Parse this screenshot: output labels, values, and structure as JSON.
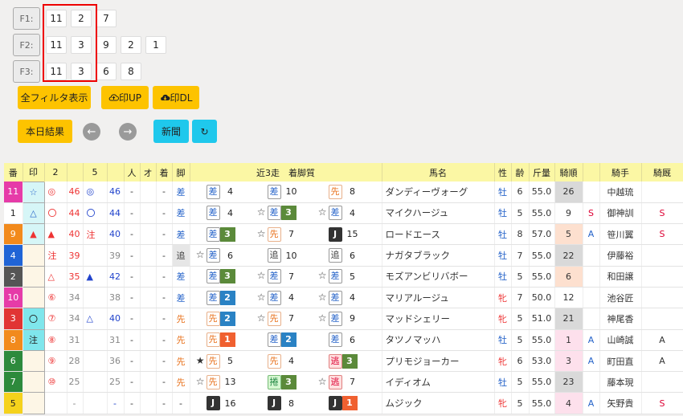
{
  "filters": [
    {
      "label": "F1:",
      "values": [
        "11",
        "2",
        "7"
      ]
    },
    {
      "label": "F2:",
      "values": [
        "11",
        "3",
        "9",
        "2",
        "1"
      ]
    },
    {
      "label": "F3:",
      "values": [
        "11",
        "3",
        "6",
        "8"
      ]
    }
  ],
  "buttons": {
    "all_filter": "全フィルタ表示",
    "mark_up": "印UP",
    "mark_dl": "印DL",
    "today_results": "本日結果",
    "newspaper": "新聞",
    "prev": "←",
    "next": "→",
    "refresh": "↻"
  },
  "colors": {
    "accent_yellow": "#fdc300",
    "accent_cyan": "#1fc8ec",
    "header_bg": "#fbf7a4",
    "red_box": "#ee0000"
  },
  "table": {
    "headers": [
      "番",
      "印",
      "2",
      "",
      "5",
      "",
      "人",
      "オ",
      "着",
      "脚",
      "近3走　着脚質",
      "馬名",
      "性",
      "齢",
      "斤量",
      "騎順",
      "",
      "騎手",
      "騎厩"
    ],
    "rows": [
      {
        "num": "11",
        "nc": "#e63ba8",
        "mark": "☆",
        "mc": "#2563c9",
        "mbg": "#d6f6f7",
        "s2": "◎",
        "v2": "46",
        "s5": "◎",
        "v5": "46",
        "ninki": "-",
        "o": "",
        "chaku": "-",
        "kyaku": "差",
        "kt": "s",
        "r": [
          {
            "st": "",
            "b": "差",
            "bt": "",
            "p": "4",
            "pc": ""
          },
          {
            "st": "",
            "b": "差",
            "bt": "",
            "p": "10",
            "pc": ""
          },
          {
            "st": "",
            "b": "先",
            "bt": "o",
            "p": "8",
            "pc": ""
          }
        ],
        "name": "ダンディーヴォーグ",
        "sex": "牡",
        "sf": false,
        "age": "6",
        "kin": "55.0",
        "jun": "26",
        "jbg": "#d9d9d9",
        "flag": "",
        "jockey": "中越琉",
        "kk": ""
      },
      {
        "num": "1",
        "nc": "#ffffff",
        "mark": "△",
        "mc": "#2563c9",
        "mbg": "#d6f6f7",
        "s2": "〇",
        "v2": "44",
        "s5": "〇",
        "v5": "44",
        "ninki": "-",
        "o": "",
        "chaku": "-",
        "kyaku": "差",
        "kt": "s",
        "r": [
          {
            "st": "",
            "b": "差",
            "bt": "",
            "p": "4",
            "pc": ""
          },
          {
            "st": "☆",
            "b": "差",
            "bt": "",
            "p": "3",
            "pc": "#5b8a3a"
          },
          {
            "st": "☆",
            "b": "差",
            "bt": "",
            "p": "4",
            "pc": ""
          }
        ],
        "name": "マイクハージュ",
        "sex": "牡",
        "sf": false,
        "age": "5",
        "kin": "55.0",
        "jun": "9",
        "jbg": "#ffffff",
        "flag": "S",
        "jockey": "御神訓",
        "kk": "S"
      },
      {
        "num": "9",
        "nc": "#f28a1c",
        "mark": "▲",
        "mc": "#e33",
        "mbg": "#d6f6f7",
        "s2": "▲",
        "v2": "40",
        "s5": "注",
        "v5": "40",
        "ninki": "-",
        "o": "",
        "chaku": "-",
        "kyaku": "差",
        "kt": "s",
        "r": [
          {
            "st": "",
            "b": "差",
            "bt": "",
            "p": "3",
            "pc": "#5b8a3a"
          },
          {
            "st": "☆",
            "b": "先",
            "bt": "o",
            "p": "7",
            "pc": ""
          },
          {
            "st": "",
            "b": "J",
            "bt": "jj",
            "p": "15",
            "pc": ""
          }
        ],
        "name": "ロードエース",
        "sex": "牡",
        "sf": false,
        "age": "8",
        "kin": "57.0",
        "jun": "5",
        "jbg": "#fde0cf",
        "flag": "A",
        "jockey": "笹川翼",
        "kk": "S"
      },
      {
        "num": "4",
        "nc": "#1f64d6",
        "mark": "",
        "mc": "",
        "mbg": "#fdf6e6",
        "s2": "注",
        "v2": "39",
        "s5": "",
        "v5": "39",
        "ninki": "-",
        "o": "",
        "chaku": "-",
        "kyaku": "追",
        "kt": "oi",
        "r": [
          {
            "st": "☆",
            "b": "差",
            "bt": "",
            "p": "6",
            "pc": ""
          },
          {
            "st": "",
            "b": "追",
            "bt": "g",
            "p": "10",
            "pc": ""
          },
          {
            "st": "",
            "b": "追",
            "bt": "g",
            "p": "6",
            "pc": ""
          }
        ],
        "name": "ナガタブラック",
        "sex": "牡",
        "sf": false,
        "age": "7",
        "kin": "55.0",
        "jun": "22",
        "jbg": "#d9d9d9",
        "flag": "",
        "jockey": "伊藤裕",
        "kk": ""
      },
      {
        "num": "2",
        "nc": "#555555",
        "mark": "",
        "mc": "",
        "mbg": "#fdf6e6",
        "s2": "△",
        "v2": "35",
        "s5": "▲",
        "v5": "42",
        "ninki": "-",
        "o": "",
        "chaku": "-",
        "kyaku": "差",
        "kt": "s",
        "r": [
          {
            "st": "",
            "b": "差",
            "bt": "",
            "p": "3",
            "pc": "#5b8a3a"
          },
          {
            "st": "☆",
            "b": "差",
            "bt": "",
            "p": "7",
            "pc": ""
          },
          {
            "st": "☆",
            "b": "差",
            "bt": "",
            "p": "5",
            "pc": ""
          }
        ],
        "name": "モズアンビリバボー",
        "sex": "牡",
        "sf": false,
        "age": "5",
        "kin": "55.0",
        "jun": "6",
        "jbg": "#fde0cf",
        "flag": "",
        "jockey": "和田譲",
        "kk": ""
      },
      {
        "num": "10",
        "nc": "#e63ba8",
        "mark": "",
        "mc": "",
        "mbg": "#fdf6e6",
        "s2": "⑥",
        "v2": "34",
        "s5": "",
        "v5": "38",
        "ninki": "-",
        "o": "",
        "chaku": "-",
        "kyaku": "差",
        "kt": "s",
        "r": [
          {
            "st": "",
            "b": "差",
            "bt": "",
            "p": "2",
            "pc": "#2a82c4"
          },
          {
            "st": "☆",
            "b": "差",
            "bt": "",
            "p": "4",
            "pc": ""
          },
          {
            "st": "☆",
            "b": "差",
            "bt": "",
            "p": "4",
            "pc": ""
          }
        ],
        "name": "マリアルージュ",
        "sex": "牝",
        "sf": true,
        "age": "7",
        "kin": "50.0",
        "jun": "12",
        "jbg": "#ffffff",
        "flag": "",
        "jockey": "池谷匠",
        "kk": ""
      },
      {
        "num": "3",
        "nc": "#e13434",
        "mark": "〇",
        "mc": "#222",
        "mbg": "#7fe6ec",
        "s2": "⑦",
        "v2": "34",
        "s5": "△",
        "v5": "40",
        "ninki": "-",
        "o": "",
        "chaku": "-",
        "kyaku": "先",
        "kt": "nige",
        "r": [
          {
            "st": "",
            "b": "先",
            "bt": "o",
            "p": "2",
            "pc": "#2a82c4"
          },
          {
            "st": "☆",
            "b": "先",
            "bt": "o",
            "p": "7",
            "pc": ""
          },
          {
            "st": "☆",
            "b": "差",
            "bt": "",
            "p": "9",
            "pc": ""
          }
        ],
        "name": "マッドシェリー",
        "sex": "牝",
        "sf": true,
        "age": "5",
        "kin": "51.0",
        "jun": "21",
        "jbg": "#d9d9d9",
        "flag": "",
        "jockey": "神尾香",
        "kk": ""
      },
      {
        "num": "8",
        "nc": "#f28a1c",
        "mark": "注",
        "mc": "#222",
        "mbg": "#7fe6ec",
        "s2": "⑧",
        "v2": "31",
        "s5": "",
        "v5": "31",
        "ninki": "-",
        "o": "",
        "chaku": "-",
        "kyaku": "先",
        "kt": "nige",
        "r": [
          {
            "st": "",
            "b": "先",
            "bt": "o",
            "p": "1",
            "pc": "#f06030"
          },
          {
            "st": "",
            "b": "差",
            "bt": "",
            "p": "2",
            "pc": "#2a82c4"
          },
          {
            "st": "",
            "b": "差",
            "bt": "",
            "p": "6",
            "pc": ""
          }
        ],
        "name": "タツノマッハ",
        "sex": "牡",
        "sf": false,
        "age": "5",
        "kin": "55.0",
        "jun": "1",
        "jbg": "#fde0ec",
        "flag": "A",
        "jockey": "山崎誠",
        "kk": "A"
      },
      {
        "num": "6",
        "nc": "#2d8a3c",
        "mark": "",
        "mc": "",
        "mbg": "#fdf6e6",
        "s2": "⑨",
        "v2": "28",
        "s5": "",
        "v5": "36",
        "ninki": "-",
        "o": "",
        "chaku": "-",
        "kyaku": "先",
        "kt": "nige",
        "r": [
          {
            "st": "★",
            "b": "先",
            "bt": "o",
            "p": "5",
            "pc": ""
          },
          {
            "st": "",
            "b": "先",
            "bt": "o",
            "p": "4",
            "pc": ""
          },
          {
            "st": "",
            "b": "逃",
            "bt": "n",
            "p": "3",
            "pc": "#5b8a3a"
          }
        ],
        "name": "プリモジョーカー",
        "sex": "牝",
        "sf": true,
        "age": "6",
        "kin": "53.0",
        "jun": "3",
        "jbg": "#fde0ec",
        "flag": "A",
        "jockey": "町田直",
        "kk": "A"
      },
      {
        "num": "7",
        "nc": "#2d8a3c",
        "mark": "",
        "mc": "",
        "mbg": "#fdf6e6",
        "s2": "⑩",
        "v2": "25",
        "s5": "",
        "v5": "25",
        "ninki": "-",
        "o": "",
        "chaku": "-",
        "kyaku": "先",
        "kt": "nige",
        "r": [
          {
            "st": "☆",
            "b": "先",
            "bt": "o",
            "p": "13",
            "pc": ""
          },
          {
            "st": "",
            "b": "捲",
            "bt": "ma",
            "p": "3",
            "pc": "#5b8a3a"
          },
          {
            "st": "☆",
            "b": "逃",
            "bt": "n",
            "p": "7",
            "pc": ""
          }
        ],
        "name": "イディオム",
        "sex": "牡",
        "sf": false,
        "age": "5",
        "kin": "55.0",
        "jun": "23",
        "jbg": "#d9d9d9",
        "flag": "",
        "jockey": "藤本現",
        "kk": ""
      },
      {
        "num": "5",
        "nc": "#f5d21c",
        "mark": "",
        "mc": "",
        "mbg": "#fdf6e6",
        "s2": "",
        "v2": "-",
        "s5": "",
        "v5": "-",
        "ninki": "-",
        "o": "",
        "chaku": "-",
        "kyaku": "-",
        "kt": "s",
        "r": [
          {
            "st": "",
            "b": "J",
            "bt": "jj",
            "p": "16",
            "pc": ""
          },
          {
            "st": "",
            "b": "J",
            "bt": "jj",
            "p": "8",
            "pc": ""
          },
          {
            "st": "",
            "b": "J",
            "bt": "jj",
            "p": "1",
            "pc": "#f06030"
          }
        ],
        "name": "ムジック",
        "sex": "牝",
        "sf": true,
        "age": "5",
        "kin": "55.0",
        "jun": "4",
        "jbg": "#fde0ec",
        "flag": "A",
        "jockey": "矢野貴",
        "kk": "S"
      }
    ]
  }
}
